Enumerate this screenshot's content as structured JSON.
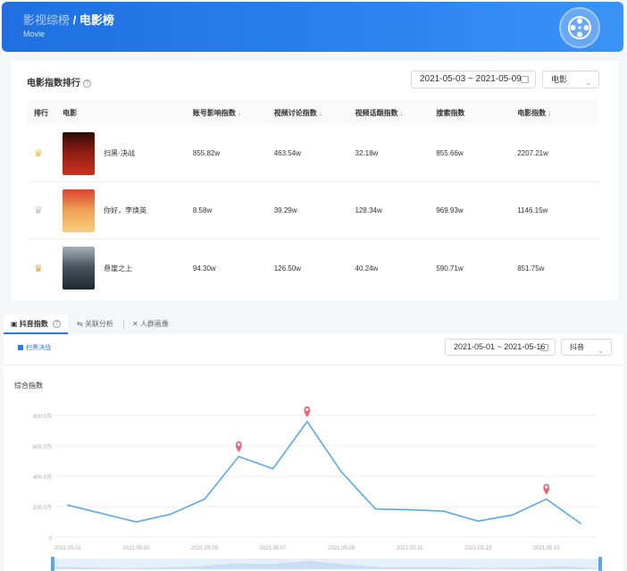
{
  "header": {
    "crumb": "影视综榜",
    "separator": " / ",
    "title": "电影榜",
    "subtitle": "Movie",
    "logo_icon": "film-reel-icon"
  },
  "ranking": {
    "title": "电影指数排行",
    "date_range": "2021-05-03 ~ 2021-05-09",
    "category": "电影",
    "columns": [
      "排行",
      "电影",
      "账号影响指数",
      "视频讨论指数",
      "视频话题指数",
      "搜索指数",
      "电影指数"
    ],
    "sortable": [
      false,
      false,
      true,
      true,
      true,
      false,
      true
    ],
    "rows": [
      {
        "rank_icon": "gold-crown-icon",
        "rank_color": "#f2b84b",
        "title": "扫黑·决战",
        "values": [
          "855.82w",
          "463.54w",
          "32.18w",
          "855.66w",
          "2207.21w"
        ]
      },
      {
        "rank_icon": "silver-crown-icon",
        "rank_color": "#b9bcc2",
        "title": "你好，李焕英",
        "values": [
          "8.58w",
          "39.29w",
          "128.34w",
          "969.93w",
          "1146.15w"
        ]
      },
      {
        "rank_icon": "bronze-crown-icon",
        "rank_color": "#d7a04d",
        "title": "悬崖之上",
        "values": [
          "94.30w",
          "126.50w",
          "40.24w",
          "590.71w",
          "851.75w"
        ]
      }
    ]
  },
  "index_panel": {
    "tabs": [
      {
        "label": "抖音指数",
        "icon": "chart-box-icon",
        "active": true
      },
      {
        "label": "关联分析",
        "icon": "link-icon",
        "active": false
      },
      {
        "label": "人群画像",
        "icon": "people-icon",
        "active": false
      }
    ],
    "legend": "扫黑决战",
    "date_range": "2021-05-01 ~ 2021-05-16",
    "platform": "抖音",
    "accent": "#2b7be6"
  },
  "chart_data": {
    "type": "line",
    "title": "综合指数",
    "x": [
      "2021.05.01",
      "2021.05.02",
      "2021.05.03",
      "2021.05.04",
      "2021.05.05",
      "2021.05.06",
      "2021.05.07",
      "2021.05.08",
      "2021.05.09",
      "2021.05.10",
      "2021.05.11",
      "2021.05.12",
      "2021.05.13",
      "2021.05.14",
      "2021.05.15",
      "2021.05.16"
    ],
    "x_tick_labels": [
      "2021.05.01",
      "2021.05.03",
      "2021.05.05",
      "2021.05.07",
      "2021.05.09",
      "2021.05.11",
      "2021.05.13",
      "2021.05.15"
    ],
    "series": [
      {
        "values": [
          210,
          155,
          100,
          150,
          250,
          530,
          450,
          760,
          430,
          185,
          180,
          170,
          105,
          145,
          250,
          90
        ]
      }
    ],
    "markers_at": [
      "2021.05.06",
      "2021.05.08",
      "2021.05.15"
    ],
    "yticks": [
      0,
      200,
      400,
      600,
      800
    ],
    "ytick_labels": [
      "0",
      "200.0万",
      "400.0万",
      "600.0万",
      "800.0万"
    ],
    "ylim": [
      0,
      800
    ],
    "line_color": "#5aa9e6",
    "marker_color": "#e8657a",
    "grid": true
  }
}
